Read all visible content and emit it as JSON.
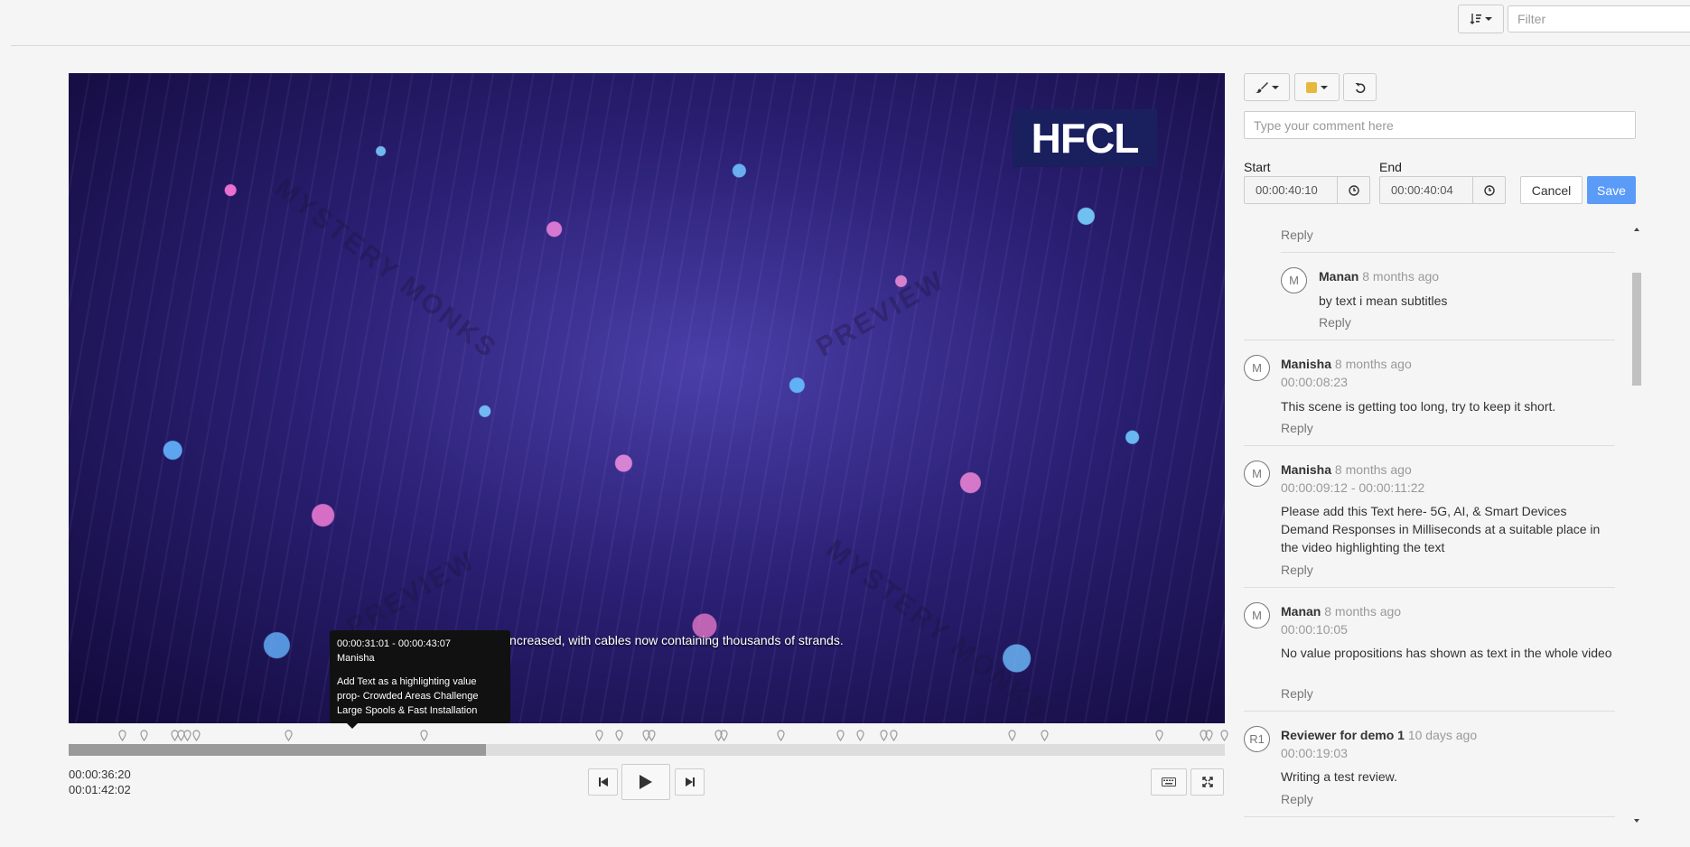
{
  "toolbar": {
    "filter_placeholder": "Filter",
    "sort_icon": "sort-amount-icon"
  },
  "video": {
    "logo_text": "HFCL",
    "watermarks": [
      "MYSTERY MONKS",
      "PREVIEW",
      "MYSTERY MONKS",
      "PREVIEW"
    ],
    "subtitle": "... counts have increased, with cables now containing thousands of strands.",
    "progress_fraction": 0.361,
    "marker_count": 30
  },
  "tooltip": {
    "time_range": "00:00:31:01 - 00:00:43:07",
    "user": "Manisha",
    "text": "Add Text as a highlighting value\nprop- Crowded Areas Challenge\nLarge Spools & Fast Installation"
  },
  "playback": {
    "current_time": "00:00:36:20",
    "total_time": "00:01:42:02"
  },
  "editor": {
    "brush_icon": "paintbrush-icon",
    "color": "#e6b83d",
    "undo_icon": "undo-icon",
    "comment_placeholder": "Type your comment here",
    "start_label": "Start",
    "end_label": "End",
    "start_value": "00:00:40:10",
    "end_value": "00:00:40:04",
    "cancel_label": "Cancel",
    "save_label": "Save"
  },
  "comments": {
    "top_reply": "Reply",
    "items": [
      {
        "avatar": "M",
        "author": "Manan",
        "ago": "8 months ago",
        "time": "",
        "text": "by text i mean subtitles",
        "reply": "Reply"
      },
      {
        "avatar": "M",
        "author": "Manisha",
        "ago": "8 months ago",
        "time": "00:00:08:23",
        "text": "This scene is getting too long, try to keep it short.",
        "reply": "Reply"
      },
      {
        "avatar": "M",
        "author": "Manisha",
        "ago": "8 months ago",
        "time": "00:00:09:12 - 00:00:11:22",
        "text": "Please add this Text here- 5G, AI, & Smart Devices Demand Responses in Milliseconds at a suitable place in the video highlighting the text",
        "reply": "Reply"
      },
      {
        "avatar": "M",
        "author": "Manan",
        "ago": "8 months ago",
        "time": "00:00:10:05",
        "text": "No value propositions has shown as text in the whole video",
        "reply": "Reply"
      },
      {
        "avatar": "R1",
        "author": "Reviewer for demo 1",
        "ago": "10 days ago",
        "time": "00:00:19:03",
        "text": "Writing a test review.",
        "reply": "Reply"
      }
    ]
  }
}
